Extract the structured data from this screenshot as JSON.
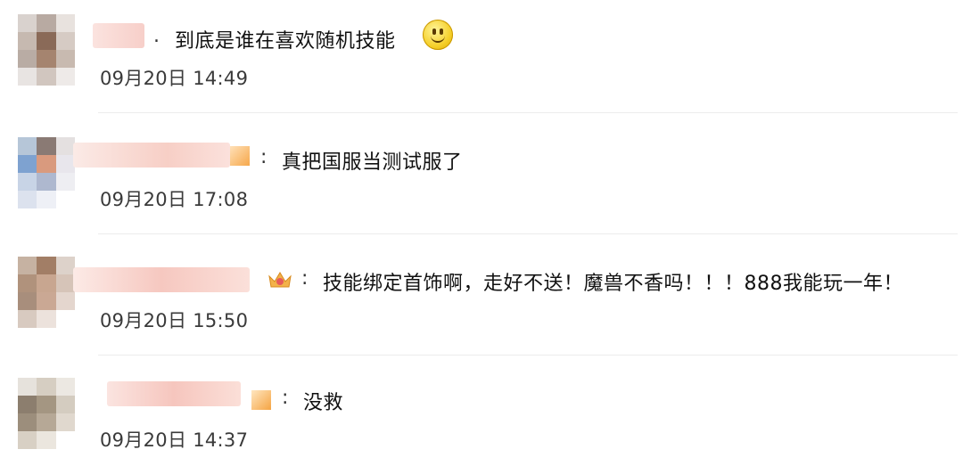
{
  "comments": [
    {
      "separator": ".",
      "text": "到底是谁在喜欢随机技能",
      "time": "09月20日 14:49",
      "emoji": "smile-emoji"
    },
    {
      "separator": ":",
      "text": "真把国服当测试服了",
      "time": "09月20日 17:08"
    },
    {
      "separator": ":",
      "text": "技能绑定首饰啊，走好不送！魔兽不香吗！！！888我能玩一年！",
      "time": "09月20日 15:50",
      "badge": "crown-badge"
    },
    {
      "separator": ":",
      "text": "没救",
      "time": "09月20日 14:37"
    }
  ],
  "colors": {
    "divider": "#ececec",
    "time_text": "#3a3a3a",
    "blur_pink": "#f9d5d0"
  }
}
